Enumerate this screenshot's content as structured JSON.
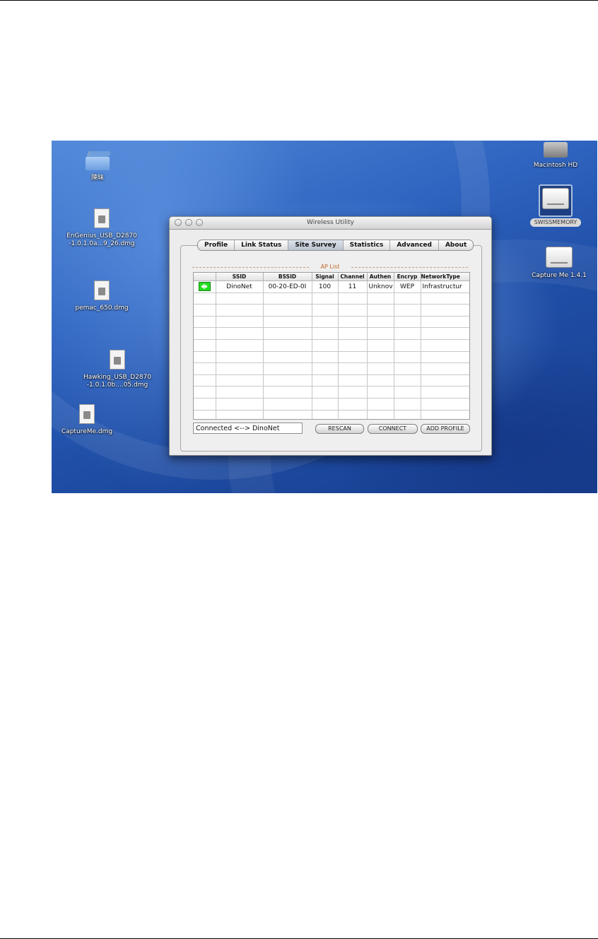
{
  "desktop": {
    "icons": {
      "folder": "陳昧",
      "engenius": [
        "EnGenius_USB_D2870",
        "-1.0.1.0a...9_26.dmg"
      ],
      "pemac": "pemac_650.dmg",
      "hawking": [
        "Hawking_USB_D2870",
        "-1.0.1.0b....05.dmg"
      ],
      "captureme": "CaptureMe.dmg",
      "macintosh_hd": "Macintosh HD",
      "swissmemory": "SWISSMEMORY",
      "capture_me": "Capture Me 1.4.1"
    }
  },
  "window": {
    "title": "Wireless Utility",
    "tabs": [
      "Profile",
      "Link Status",
      "Site Survey",
      "Statistics",
      "Advanced",
      "About"
    ],
    "active_tab": "Site Survey",
    "ap_list_title": "AP List",
    "columns": [
      "",
      "SSID",
      "BSSID",
      "Signal",
      "Channel",
      "Authen",
      "Encryp",
      "NetworkType"
    ],
    "rows": [
      {
        "ssid": "DinoNet",
        "bssid": "00-20-ED-0I",
        "signal": "100",
        "channel": "11",
        "authen": "Unknov",
        "encryp": "WEP",
        "network_type": "Infrastructur"
      }
    ],
    "status": "Connected <--> DinoNet",
    "buttons": {
      "rescan": "RESCAN",
      "connect": "CONNECT",
      "add_profile": "ADD PROFILE"
    }
  },
  "colors": {
    "accent": "#c06a2b",
    "signal_icon": "#22dd22",
    "desktop_blue": "#2f64c0"
  }
}
